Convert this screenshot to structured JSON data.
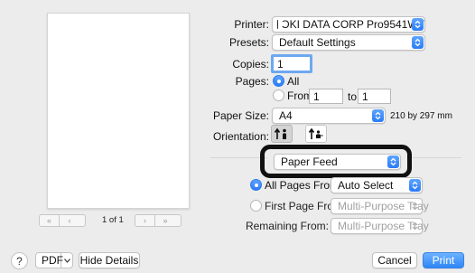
{
  "preview": {
    "page_indicator": "1 of 1"
  },
  "printer": {
    "label": "Printer:",
    "value": "OKI DATA CORP Pro9541WT"
  },
  "presets": {
    "label": "Presets:",
    "value": "Default Settings"
  },
  "copies": {
    "label": "Copies:",
    "value": "1"
  },
  "pages": {
    "label": "Pages:",
    "all_label": "All",
    "from_label": "From:",
    "from_value": "1",
    "to_label": "to:",
    "to_value": "1"
  },
  "paper_size": {
    "label": "Paper Size:",
    "value": "A4",
    "dimensions": "210 by 297 mm"
  },
  "orientation": {
    "label": "Orientation:"
  },
  "section": {
    "value": "Paper Feed"
  },
  "paper_feed": {
    "all_pages_label": "All Pages From:",
    "all_pages_value": "Auto Select",
    "first_page_label": "First Page From:",
    "first_page_value": "Multi-Purpose Tray",
    "remaining_label": "Remaining From:",
    "remaining_value": "Multi-Purpose Tray"
  },
  "footer": {
    "help": "?",
    "pdf": "PDF",
    "hide_details": "Hide Details",
    "cancel": "Cancel",
    "print": "Print"
  },
  "colors": {
    "accent": "#2b7bf4",
    "highlight_border": "#111111"
  }
}
